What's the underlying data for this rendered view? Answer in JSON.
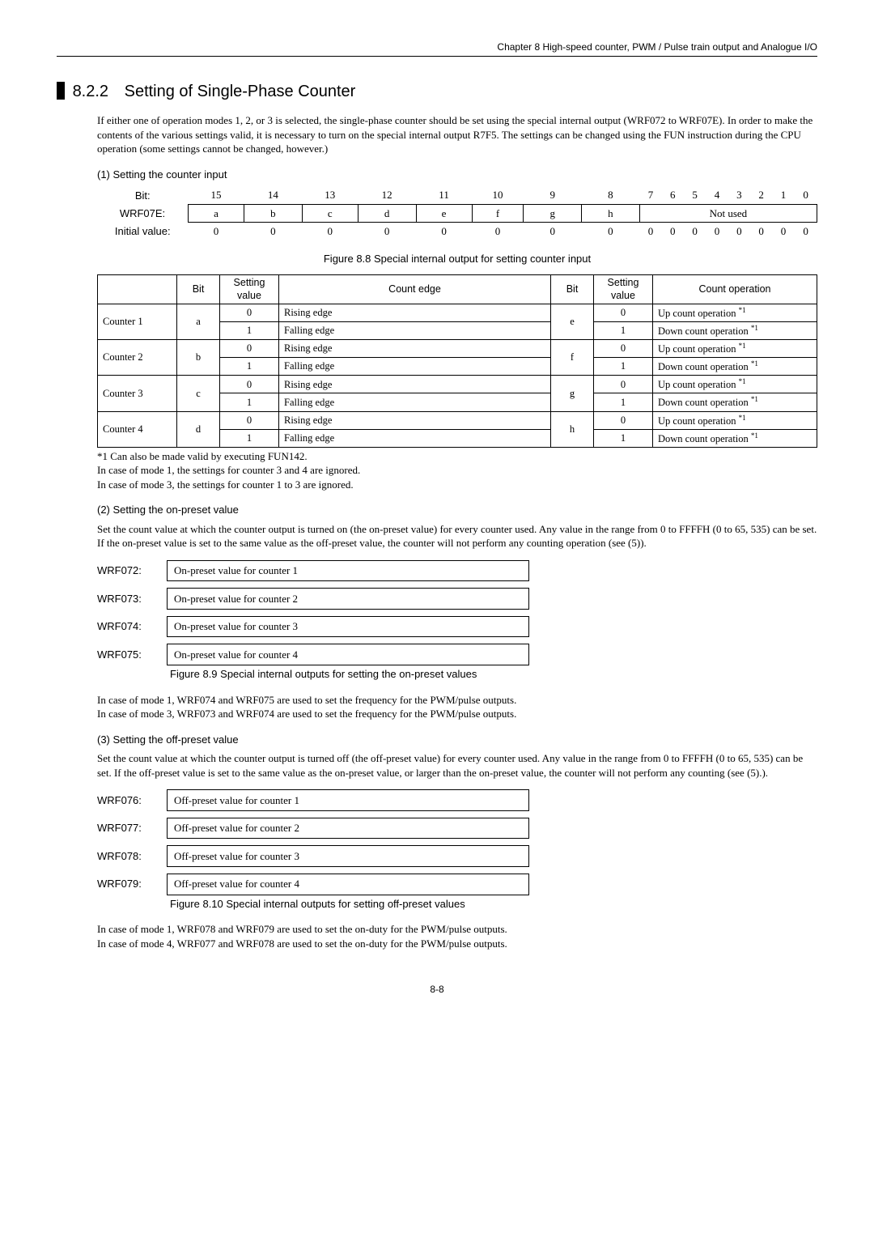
{
  "header": {
    "chapter": "Chapter 8  High-speed counter, PWM / Pulse train output and Analogue I/O"
  },
  "section": {
    "num": "8.2.2",
    "title": "Setting of Single-Phase Counter",
    "intro": "If either one of operation modes 1, 2, or 3 is selected, the single-phase counter should be set using the special internal output (WRF072 to WRF07E). In order to make the contents of the various settings valid, it is necessary to turn on the special internal output R7F5. The settings can be changed using the FUN instruction during the CPU operation (some settings cannot be changed, however.)"
  },
  "part1": {
    "title": "(1)  Setting the counter input",
    "bit_label": "Bit:",
    "bits": [
      "15",
      "14",
      "13",
      "12",
      "11",
      "10",
      "9",
      "8",
      "7",
      "6",
      "5",
      "4",
      "3",
      "2",
      "1",
      "0"
    ],
    "wrf_label": "WRF07E:",
    "cells": [
      "a",
      "b",
      "c",
      "d",
      "e",
      "f",
      "g",
      "h"
    ],
    "not_used": "Not used",
    "initial_label": "Initial value:",
    "initial": [
      "0",
      "0",
      "0",
      "0",
      "0",
      "0",
      "0",
      "0",
      "0",
      "0",
      "0",
      "0",
      "0",
      "0",
      "0",
      "0"
    ],
    "fig_caption": "Figure 8.8 Special internal output for setting counter input",
    "headers": [
      "",
      "Bit",
      "Setting value",
      "Count edge",
      "Bit",
      "Setting value",
      "Count operation"
    ],
    "rows": [
      {
        "name": "Counter 1",
        "b1": "a",
        "sv1a": "0",
        "ce1a": "Rising edge",
        "b2": "e",
        "sv2a": "0",
        "co2a": "Up count operation",
        "sv1b": "1",
        "ce1b": "Falling edge",
        "sv2b": "1",
        "co2b": "Down count operation"
      },
      {
        "name": "Counter 2",
        "b1": "b",
        "sv1a": "0",
        "ce1a": "Rising edge",
        "b2": "f",
        "sv2a": "0",
        "co2a": "Up count operation",
        "sv1b": "1",
        "ce1b": "Falling edge",
        "sv2b": "1",
        "co2b": "Down count operation"
      },
      {
        "name": "Counter 3",
        "b1": "c",
        "sv1a": "0",
        "ce1a": "Rising edge",
        "b2": "g",
        "sv2a": "0",
        "co2a": "Up count operation",
        "sv1b": "1",
        "ce1b": "Falling edge",
        "sv2b": "1",
        "co2b": "Down count operation"
      },
      {
        "name": "Counter 4",
        "b1": "d",
        "sv1a": "0",
        "ce1a": "Rising edge",
        "b2": "h",
        "sv2a": "0",
        "co2a": "Up count operation",
        "sv1b": "1",
        "ce1b": "Falling edge",
        "sv2b": "1",
        "co2b": "Down count operation"
      }
    ],
    "sup": "*1",
    "note_star": "*1  Can also be made valid by executing FUN142.",
    "note_mode1": "In case of mode 1, the settings for counter 3 and 4 are ignored.",
    "note_mode3": "In case of mode 3, the settings for counter 1 to 3 are ignored."
  },
  "part2": {
    "title": "(2)  Setting the on-preset value",
    "desc": "Set the count value at which the counter output is turned on (the on-preset value) for every counter used. Any value in the range from 0 to FFFFH (0 to 65, 535) can be set. If the on-preset value is set to the same value as the off-preset value, the counter will not perform any counting operation (see (5)).",
    "items": [
      {
        "lbl": "WRF072:",
        "txt": "On-preset value for counter 1"
      },
      {
        "lbl": "WRF073:",
        "txt": "On-preset value for counter 2"
      },
      {
        "lbl": "WRF074:",
        "txt": "On-preset value for counter 3"
      },
      {
        "lbl": "WRF075:",
        "txt": "On-preset value for counter 4"
      }
    ],
    "fig_caption": "Figure 8.9 Special internal outputs for setting the on-preset values",
    "note_mode1": "In case of mode 1, WRF074 and WRF075 are used to set the frequency for the PWM/pulse outputs.",
    "note_mode3": "In case of mode 3, WRF073 and WRF074 are used to set the frequency for the PWM/pulse outputs."
  },
  "part3": {
    "title": "(3)  Setting the off-preset value",
    "desc": "Set the count value at which the counter output is turned off (the off-preset value) for every counter used. Any value in the range from 0 to FFFFH (0 to 65, 535) can be set. If the off-preset value is set to the same value as the on-preset value, or larger than the on-preset value, the counter will not perform any counting (see (5).).",
    "items": [
      {
        "lbl": "WRF076:",
        "txt": "Off-preset value for counter 1"
      },
      {
        "lbl": "WRF077:",
        "txt": "Off-preset value for counter 2"
      },
      {
        "lbl": "WRF078:",
        "txt": "Off-preset value for counter 3"
      },
      {
        "lbl": "WRF079:",
        "txt": "Off-preset value for counter 4"
      }
    ],
    "fig_caption": "Figure 8.10 Special internal outputs for setting off-preset values",
    "note_mode1": "In case of mode 1, WRF078 and WRF079 are used to set the on-duty for the PWM/pulse outputs.",
    "note_mode4": "In case of mode 4, WRF077 and WRF078 are used to set the on-duty for the PWM/pulse outputs."
  },
  "page_num": "8-8"
}
